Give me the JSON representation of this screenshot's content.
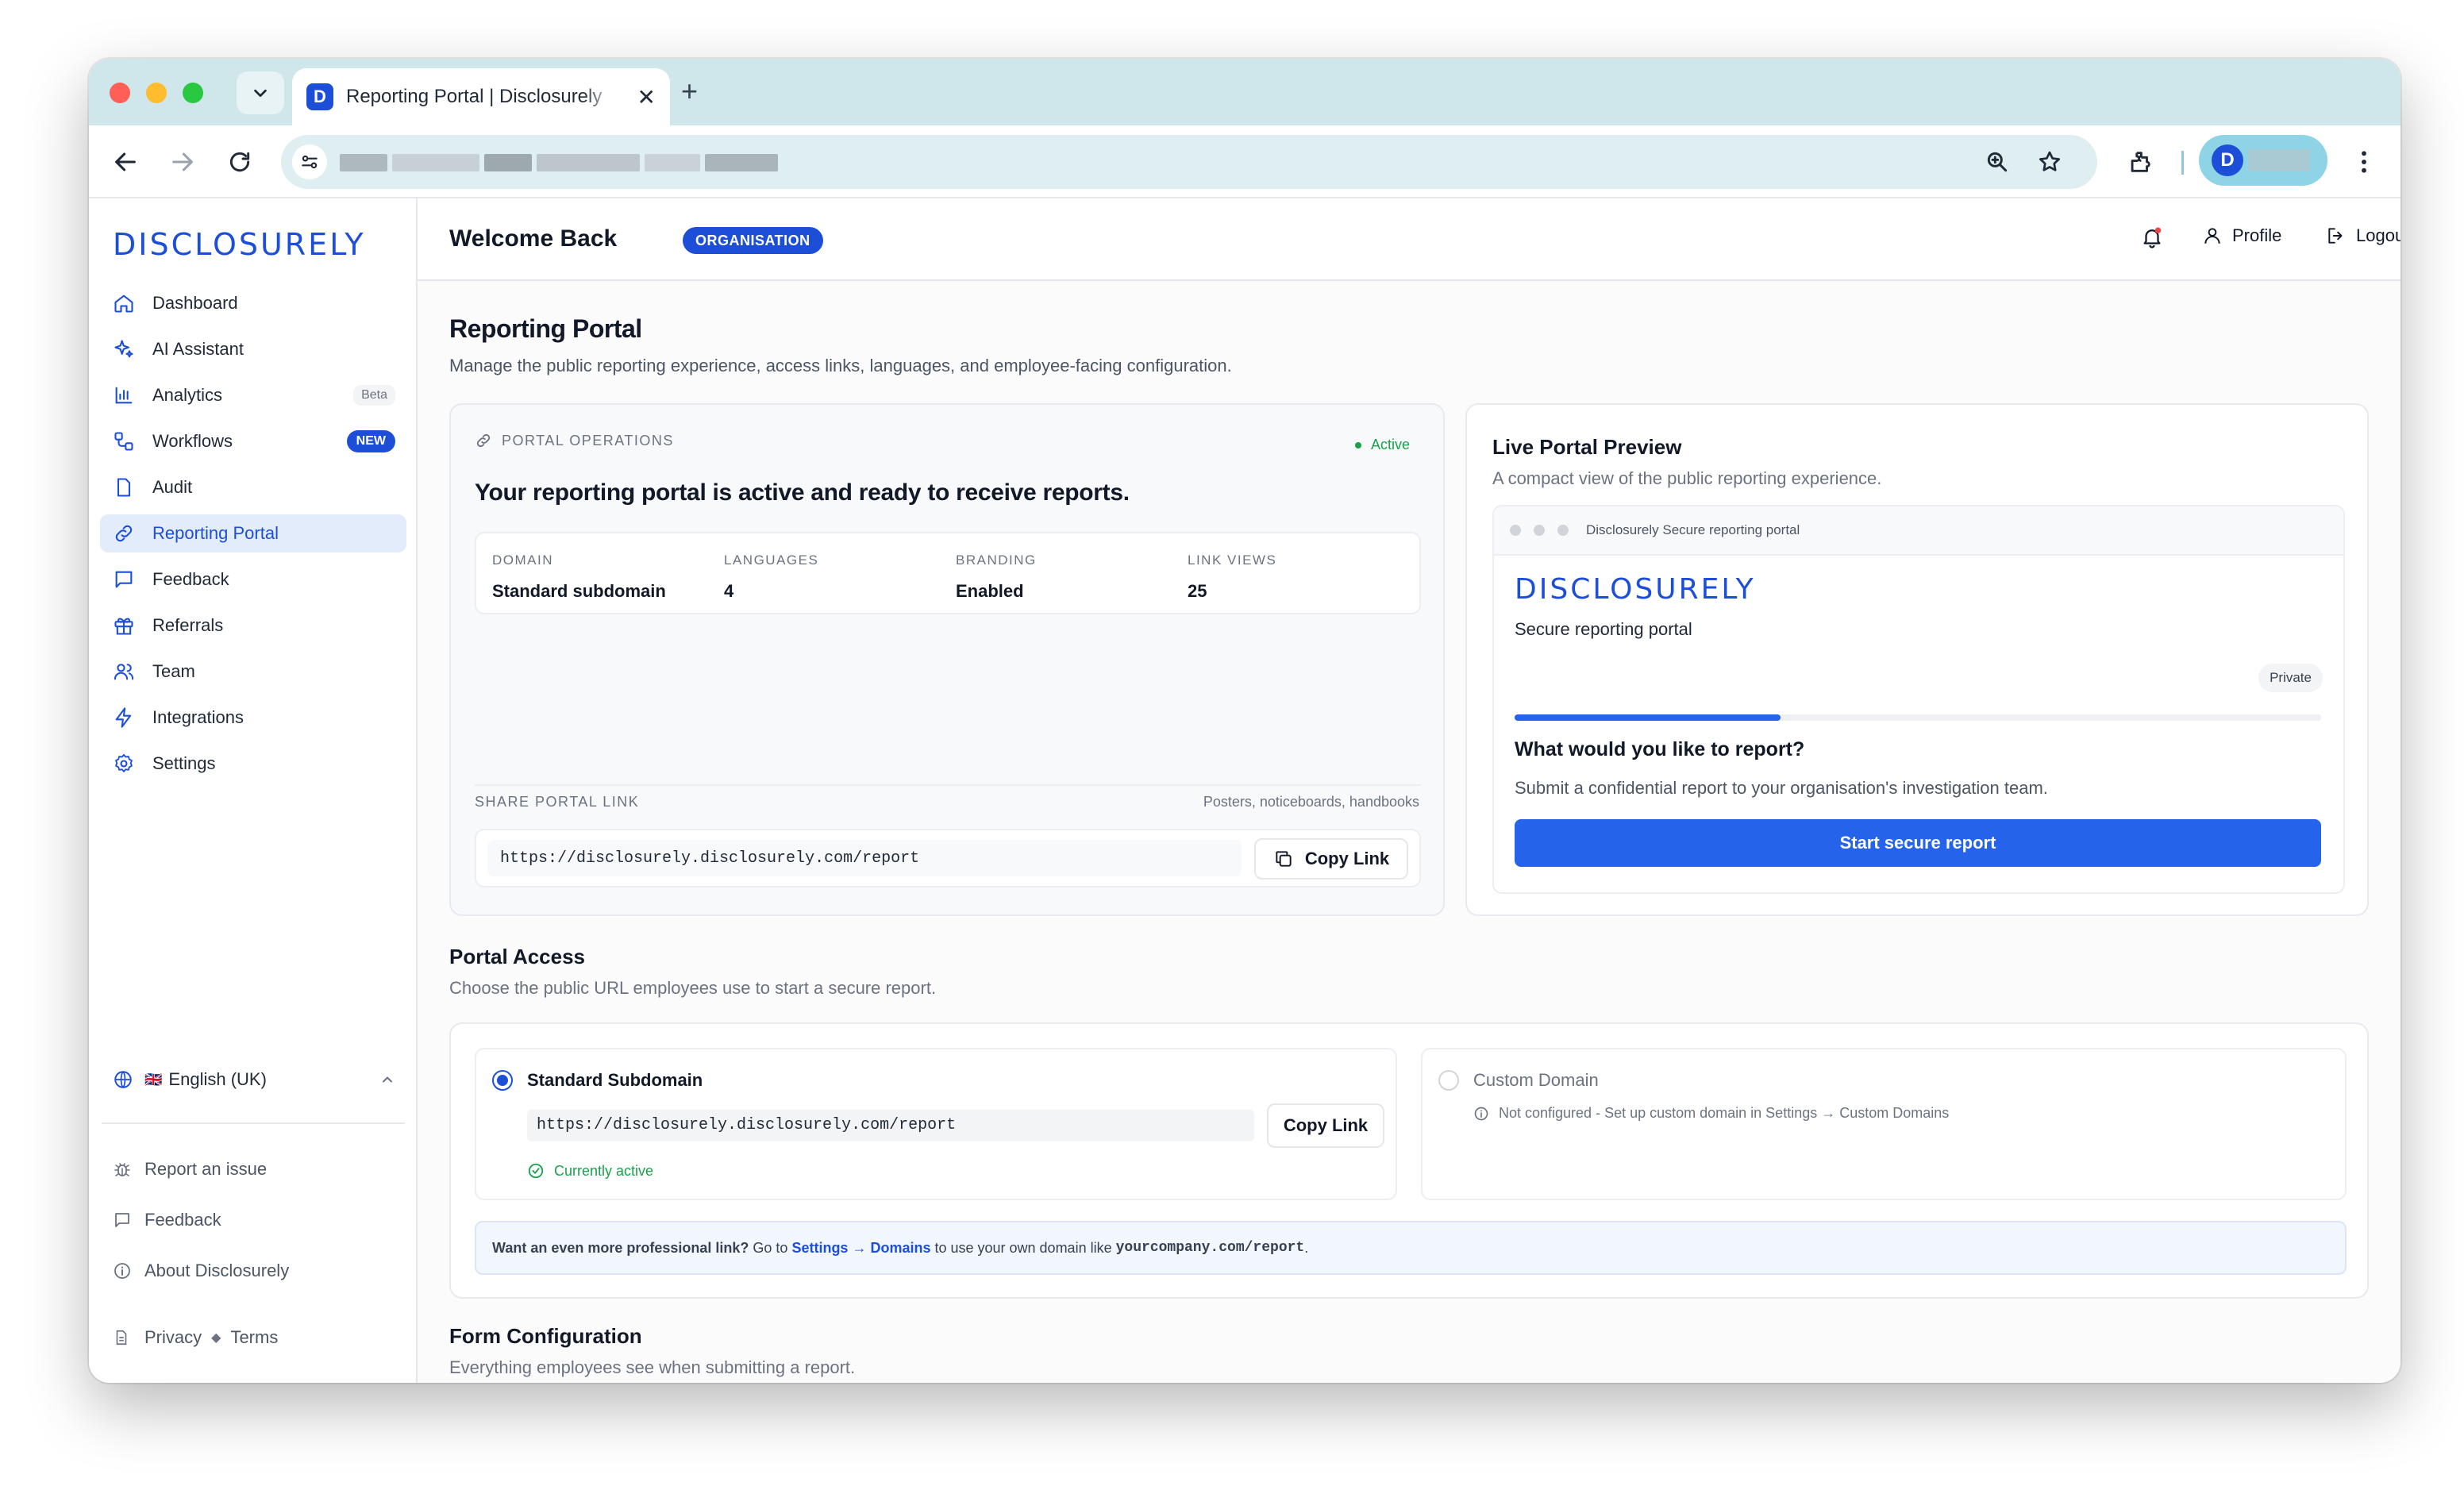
{
  "browser": {
    "tab_title": "Reporting Portal | Disclosurely",
    "tab_favicon_letter": "D",
    "new_tab_symbol": "+",
    "close_symbol": "✕",
    "profile_initial": "D"
  },
  "sidebar": {
    "brand": "DISCLOSURELY",
    "items": [
      {
        "label": "Dashboard",
        "icon": "home-icon"
      },
      {
        "label": "AI Assistant",
        "icon": "sparkles-icon"
      },
      {
        "label": "Analytics",
        "icon": "bar-chart-icon",
        "badge": "Beta"
      },
      {
        "label": "Workflows",
        "icon": "workflow-icon",
        "badge": "NEW"
      },
      {
        "label": "Audit",
        "icon": "document-icon"
      },
      {
        "label": "Reporting Portal",
        "icon": "link-icon",
        "active": true
      },
      {
        "label": "Feedback",
        "icon": "message-icon"
      },
      {
        "label": "Referrals",
        "icon": "gift-icon"
      },
      {
        "label": "Team",
        "icon": "users-icon"
      },
      {
        "label": "Integrations",
        "icon": "bolt-icon"
      },
      {
        "label": "Settings",
        "icon": "gear-icon"
      }
    ],
    "language": {
      "flag": "🇬🇧",
      "label": "English (UK)"
    },
    "footer": {
      "report_issue": "Report an issue",
      "feedback": "Feedback",
      "about": "About Disclosurely",
      "privacy": "Privacy",
      "terms": "Terms"
    }
  },
  "header": {
    "welcome": "Welcome Back",
    "org_badge": "ORGANISATION",
    "profile": "Profile",
    "logout": "Logout"
  },
  "page": {
    "title": "Reporting Portal",
    "subtitle": "Manage the public reporting experience, access links, languages, and employee-facing configuration."
  },
  "operations": {
    "caption": "PORTAL OPERATIONS",
    "status": "Active",
    "headline": "Your reporting portal is active and ready to receive reports.",
    "stats": [
      {
        "label": "DOMAIN",
        "value": "Standard subdomain"
      },
      {
        "label": "LANGUAGES",
        "value": "4"
      },
      {
        "label": "BRANDING",
        "value": "Enabled"
      },
      {
        "label": "LINK VIEWS",
        "value": "25"
      }
    ],
    "share_caption": "SHARE PORTAL LINK",
    "share_hint": "Posters, noticeboards, handbooks",
    "url": "https://disclosurely.disclosurely.com/report",
    "copy_label": "Copy Link"
  },
  "preview": {
    "title": "Live Portal Preview",
    "subtitle": "A compact view of the public reporting experience.",
    "window_caption": "Disclosurely Secure reporting portal",
    "brand": "DISCLOSURELY",
    "tagline": "Secure reporting portal",
    "private_badge": "Private",
    "progress": 0.33,
    "question": "What would you like to report?",
    "description": "Submit a confidential report to your organisation's investigation team.",
    "cta": "Start secure report"
  },
  "access": {
    "title": "Portal Access",
    "subtitle": "Choose the public URL employees use to start a secure report.",
    "standard": {
      "label": "Standard Subdomain",
      "url": "https://disclosurely.disclosurely.com/report",
      "copy": "Copy Link",
      "status": "Currently active"
    },
    "custom": {
      "label": "Custom Domain",
      "note": "Not configured - Set up custom domain in Settings → Custom Domains"
    },
    "tip": {
      "lead": "Want an even more professional link?",
      "mid": " Go to ",
      "link": "Settings → Domains",
      "after": " to use your own domain like ",
      "example": "yourcompany.com/report",
      "end": "."
    }
  },
  "form_config": {
    "title": "Form Configuration",
    "subtitle": "Everything employees see when submitting a report."
  },
  "colors": {
    "accent": "#1d4ed8",
    "cta": "#2563eb",
    "success": "#16a34a",
    "danger": "#ef4444"
  }
}
